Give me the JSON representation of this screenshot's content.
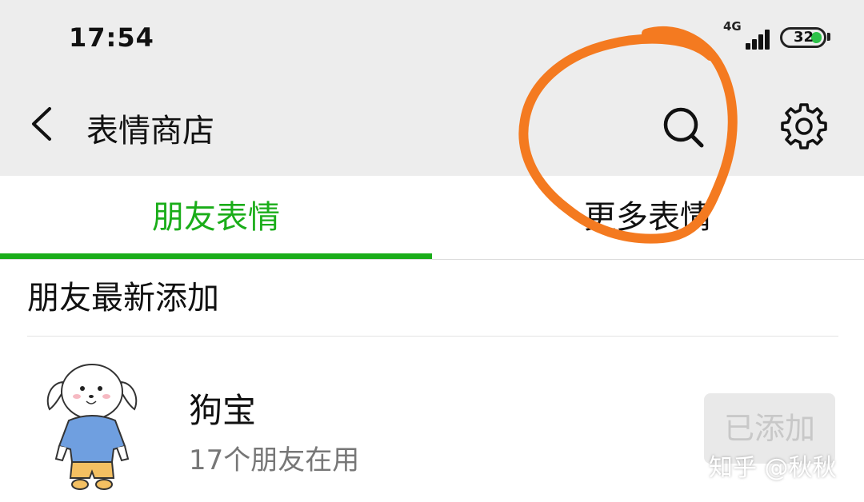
{
  "status_bar": {
    "time": "17:54",
    "network": "4G",
    "battery": "32",
    "battery_color": "#2ec24a"
  },
  "header": {
    "back_icon": "chevron-left-icon",
    "title": "表情商店",
    "search_icon": "search-icon",
    "settings_icon": "gear-icon"
  },
  "tabs": [
    {
      "label": "朋友表情",
      "active": true
    },
    {
      "label": "更多表情",
      "active": false
    }
  ],
  "accent_color": "#1aad19",
  "section": {
    "title": "朋友最新添加"
  },
  "items": [
    {
      "thumbnail_icon": "puppy-sticker-icon",
      "name": "狗宝",
      "subtitle": "17个朋友在用",
      "button_label": "已添加"
    }
  ],
  "watermark": "知乎 @秋秋",
  "annotation_color": "#f47a20"
}
